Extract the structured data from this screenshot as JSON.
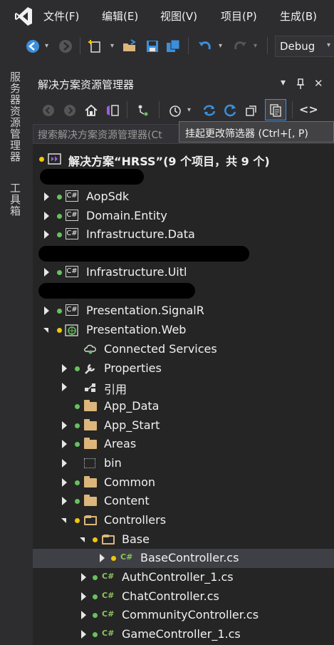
{
  "menubar": {
    "items": [
      "文件(F)",
      "编辑(E)",
      "视图(V)",
      "项目(P)",
      "生成(B)"
    ]
  },
  "toolbar": {
    "configuration": "Debug"
  },
  "side_tabs": [
    "服务器资源管理器",
    "工具箱"
  ],
  "solution_explorer": {
    "title": "解决方案资源管理器",
    "title_controls": [
      "▾",
      "⊥",
      "✕"
    ],
    "search_placeholder": "搜索解决方案资源管理器(Ct",
    "tooltip": "挂起更改筛选器 (Ctrl+[, P)",
    "solution_label": "解决方案“HRSS”(9 个项目，共 9 个)",
    "projects": {
      "p1": "AopSdk",
      "p2": "Domain.Entity",
      "p3": "Infrastructure.Data",
      "p4": "Infrastructure.Uitl",
      "p5": "Presentation.SignalR",
      "p6": "Presentation.Web"
    },
    "web_children": {
      "connected": "Connected Services",
      "properties": "Properties",
      "references": "引用",
      "app_data": "App_Data",
      "app_start": "App_Start",
      "areas": "Areas",
      "bin": "bin",
      "common": "Common",
      "content": "Content",
      "controllers": "Controllers",
      "base": "Base",
      "base_controller": "BaseController.cs",
      "auth_controller": "AuthController_1.cs",
      "chat_controller": "ChatController.cs",
      "community_controller": "CommunityController.cs",
      "game_controller": "GameController_1.cs"
    },
    "cs_badge": "C#",
    "cs_file_badge": "C#"
  },
  "colors": {
    "background": "#252526",
    "chrome": "#2d2d30",
    "selected_row": "#3f3f46",
    "accent_blue": "#3c8fdb",
    "folder": "#dcb67a",
    "status_green": "#67c15f",
    "status_yellow": "#f0c60a"
  }
}
